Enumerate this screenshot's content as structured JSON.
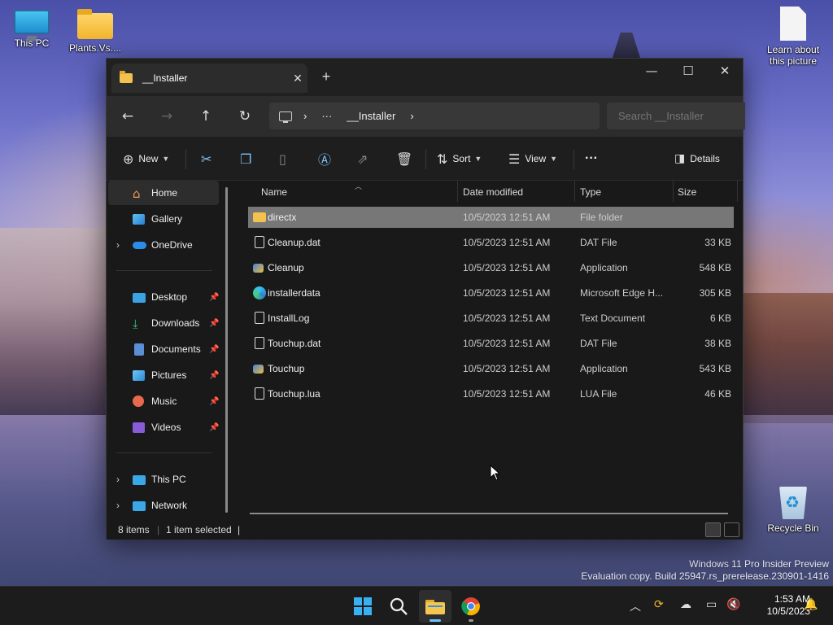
{
  "desktop": {
    "icons": [
      {
        "label": "This PC",
        "icon": "monitor-icon"
      },
      {
        "label": "Plants.Vs....",
        "icon": "folder-icon"
      },
      {
        "label": "Learn about this picture",
        "icon": "document-icon"
      },
      {
        "label": "Recycle Bin",
        "icon": "recycle-bin-icon"
      }
    ],
    "watermark": {
      "line1": "Windows 11 Pro Insider Preview",
      "line2": "Evaluation copy. Build 25947.rs_prerelease.230901-1416"
    }
  },
  "window": {
    "tab_title": "__Installer",
    "close_tab_glyph": "✕",
    "new_tab_glyph": "+",
    "controls": {
      "minimize": "—",
      "maximize": "☐",
      "close": "✕"
    }
  },
  "nav": {
    "back": "←",
    "forward": "→",
    "up": "↑",
    "refresh": "↻",
    "address": {
      "sep": "›",
      "more": "···",
      "folder": "__Installer"
    },
    "search_placeholder": "Search __Installer"
  },
  "toolbar": {
    "new_label": "New",
    "sort_label": "Sort",
    "view_label": "View",
    "more_label": "···",
    "details_label": "Details"
  },
  "sidebar": {
    "items": [
      {
        "label": "Home",
        "icon": "home-icon",
        "selected": true
      },
      {
        "label": "Gallery",
        "icon": "gallery-icon"
      },
      {
        "label": "OneDrive",
        "icon": "cloud-icon",
        "expandable": true
      },
      {
        "label": "Desktop",
        "icon": "desktop-icon",
        "pinned": true
      },
      {
        "label": "Downloads",
        "icon": "download-icon",
        "pinned": true
      },
      {
        "label": "Documents",
        "icon": "documents-icon",
        "pinned": true
      },
      {
        "label": "Pictures",
        "icon": "pictures-icon",
        "pinned": true
      },
      {
        "label": "Music",
        "icon": "music-icon",
        "pinned": true
      },
      {
        "label": "Videos",
        "icon": "videos-icon",
        "pinned": true
      },
      {
        "label": "This PC",
        "icon": "computer-icon",
        "expandable": true
      },
      {
        "label": "Network",
        "icon": "network-icon",
        "expandable": true
      }
    ]
  },
  "columns": {
    "name": "Name",
    "date": "Date modified",
    "type": "Type",
    "size": "Size"
  },
  "files": [
    {
      "name": "directx",
      "date": "10/5/2023 12:51 AM",
      "type": "File folder",
      "size": "",
      "icon": "folder-icon",
      "selected": true
    },
    {
      "name": "Cleanup.dat",
      "date": "10/5/2023 12:51 AM",
      "type": "DAT File",
      "size": "33 KB",
      "icon": "file-icon"
    },
    {
      "name": "Cleanup",
      "date": "10/5/2023 12:51 AM",
      "type": "Application",
      "size": "548 KB",
      "icon": "app-icon"
    },
    {
      "name": "installerdata",
      "date": "10/5/2023 12:51 AM",
      "type": "Microsoft Edge H...",
      "size": "305 KB",
      "icon": "edge-icon"
    },
    {
      "name": "InstallLog",
      "date": "10/5/2023 12:51 AM",
      "type": "Text Document",
      "size": "6 KB",
      "icon": "text-file-icon"
    },
    {
      "name": "Touchup.dat",
      "date": "10/5/2023 12:51 AM",
      "type": "DAT File",
      "size": "38 KB",
      "icon": "file-icon"
    },
    {
      "name": "Touchup",
      "date": "10/5/2023 12:51 AM",
      "type": "Application",
      "size": "543 KB",
      "icon": "app-icon"
    },
    {
      "name": "Touchup.lua",
      "date": "10/5/2023 12:51 AM",
      "type": "LUA File",
      "size": "46 KB",
      "icon": "file-icon"
    }
  ],
  "status": {
    "count": "8 items",
    "selection": "1 item selected"
  },
  "taskbar": {
    "time": "1:53 AM",
    "date": "10/5/2023"
  }
}
